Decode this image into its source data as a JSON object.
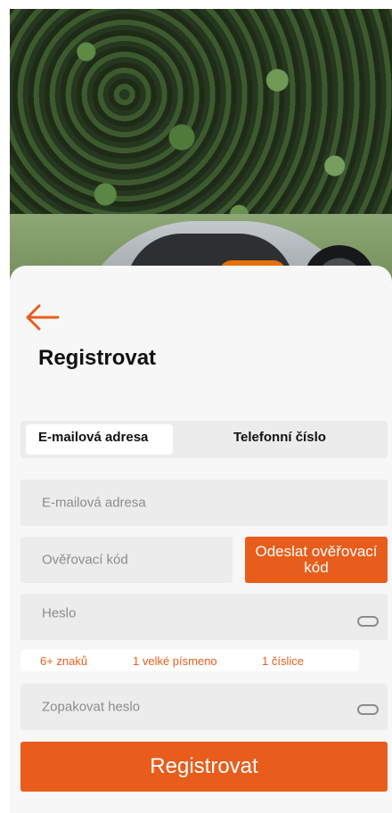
{
  "hero": {
    "description_icon": "robotic-mower-image"
  },
  "header": {
    "back_icon": "arrow-left-icon",
    "title": "Registrovat"
  },
  "tabs": [
    {
      "label": "E-mailová adresa",
      "active": true
    },
    {
      "label": "Telefonní číslo",
      "active": false
    }
  ],
  "form": {
    "email_placeholder": "E-mailová adresa",
    "code_placeholder": "Ověřovací kód",
    "send_code_label": "Odeslat ověřovací kód",
    "password_placeholder": "Heslo",
    "password_rules": [
      "6+ znaků",
      "1 velké písmeno",
      "1 číslice"
    ],
    "repeat_password_placeholder": "Zopakovat heslo",
    "submit_label": "Registrovat"
  },
  "colors": {
    "accent": "#e85d1c",
    "panel": "#f7f7f7",
    "field": "#ececec"
  }
}
